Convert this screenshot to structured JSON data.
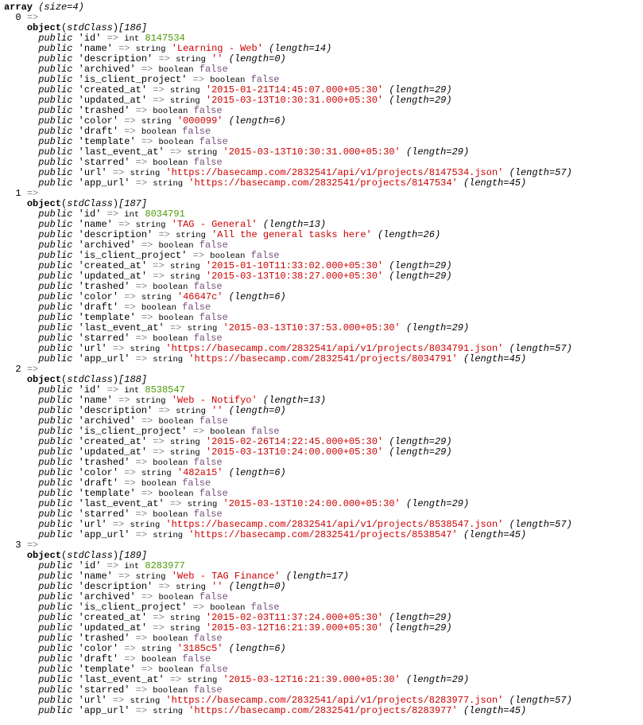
{
  "dump": {
    "root_type": "array",
    "root_size_label": "(size=4)",
    "arrow": "=>",
    "visibility": "public",
    "object_label": "object",
    "class_name": "stdClass",
    "colors": {
      "int": "#4e9a06",
      "string": "#cc0000",
      "boolean": "#75507b",
      "arrow": "#888a85"
    },
    "items": [
      {
        "index": "0",
        "handle": "[186]",
        "props": [
          {
            "key": "'id'",
            "type": "int",
            "value": "8147534",
            "meta": ""
          },
          {
            "key": "'name'",
            "type": "string",
            "value": "'Learning - Web'",
            "meta": "(length=14)"
          },
          {
            "key": "'description'",
            "type": "string",
            "value": "''",
            "meta": "(length=0)"
          },
          {
            "key": "'archived'",
            "type": "boolean",
            "value": "false",
            "meta": ""
          },
          {
            "key": "'is_client_project'",
            "type": "boolean",
            "value": "false",
            "meta": ""
          },
          {
            "key": "'created_at'",
            "type": "string",
            "value": "'2015-01-21T14:45:07.000+05:30'",
            "meta": "(length=29)"
          },
          {
            "key": "'updated_at'",
            "type": "string",
            "value": "'2015-03-13T10:30:31.000+05:30'",
            "meta": "(length=29)"
          },
          {
            "key": "'trashed'",
            "type": "boolean",
            "value": "false",
            "meta": ""
          },
          {
            "key": "'color'",
            "type": "string",
            "value": "'000099'",
            "meta": "(length=6)"
          },
          {
            "key": "'draft'",
            "type": "boolean",
            "value": "false",
            "meta": ""
          },
          {
            "key": "'template'",
            "type": "boolean",
            "value": "false",
            "meta": ""
          },
          {
            "key": "'last_event_at'",
            "type": "string",
            "value": "'2015-03-13T10:30:31.000+05:30'",
            "meta": "(length=29)"
          },
          {
            "key": "'starred'",
            "type": "boolean",
            "value": "false",
            "meta": ""
          },
          {
            "key": "'url'",
            "type": "string",
            "value": "'https://basecamp.com/2832541/api/v1/projects/8147534.json'",
            "meta": "(length=57)"
          },
          {
            "key": "'app_url'",
            "type": "string",
            "value": "'https://basecamp.com/2832541/projects/8147534'",
            "meta": "(length=45)"
          }
        ]
      },
      {
        "index": "1",
        "handle": "[187]",
        "props": [
          {
            "key": "'id'",
            "type": "int",
            "value": "8034791",
            "meta": ""
          },
          {
            "key": "'name'",
            "type": "string",
            "value": "'TAG - General'",
            "meta": "(length=13)"
          },
          {
            "key": "'description'",
            "type": "string",
            "value": "'All the general tasks here'",
            "meta": "(length=26)"
          },
          {
            "key": "'archived'",
            "type": "boolean",
            "value": "false",
            "meta": ""
          },
          {
            "key": "'is_client_project'",
            "type": "boolean",
            "value": "false",
            "meta": ""
          },
          {
            "key": "'created_at'",
            "type": "string",
            "value": "'2015-01-10T11:33:02.000+05:30'",
            "meta": "(length=29)"
          },
          {
            "key": "'updated_at'",
            "type": "string",
            "value": "'2015-03-13T10:38:27.000+05:30'",
            "meta": "(length=29)"
          },
          {
            "key": "'trashed'",
            "type": "boolean",
            "value": "false",
            "meta": ""
          },
          {
            "key": "'color'",
            "type": "string",
            "value": "'46647c'",
            "meta": "(length=6)"
          },
          {
            "key": "'draft'",
            "type": "boolean",
            "value": "false",
            "meta": ""
          },
          {
            "key": "'template'",
            "type": "boolean",
            "value": "false",
            "meta": ""
          },
          {
            "key": "'last_event_at'",
            "type": "string",
            "value": "'2015-03-13T10:37:53.000+05:30'",
            "meta": "(length=29)"
          },
          {
            "key": "'starred'",
            "type": "boolean",
            "value": "false",
            "meta": ""
          },
          {
            "key": "'url'",
            "type": "string",
            "value": "'https://basecamp.com/2832541/api/v1/projects/8034791.json'",
            "meta": "(length=57)"
          },
          {
            "key": "'app_url'",
            "type": "string",
            "value": "'https://basecamp.com/2832541/projects/8034791'",
            "meta": "(length=45)"
          }
        ]
      },
      {
        "index": "2",
        "handle": "[188]",
        "props": [
          {
            "key": "'id'",
            "type": "int",
            "value": "8538547",
            "meta": ""
          },
          {
            "key": "'name'",
            "type": "string",
            "value": "'Web - Notifyo'",
            "meta": "(length=13)"
          },
          {
            "key": "'description'",
            "type": "string",
            "value": "''",
            "meta": "(length=0)"
          },
          {
            "key": "'archived'",
            "type": "boolean",
            "value": "false",
            "meta": ""
          },
          {
            "key": "'is_client_project'",
            "type": "boolean",
            "value": "false",
            "meta": ""
          },
          {
            "key": "'created_at'",
            "type": "string",
            "value": "'2015-02-26T14:22:45.000+05:30'",
            "meta": "(length=29)"
          },
          {
            "key": "'updated_at'",
            "type": "string",
            "value": "'2015-03-13T10:24:00.000+05:30'",
            "meta": "(length=29)"
          },
          {
            "key": "'trashed'",
            "type": "boolean",
            "value": "false",
            "meta": ""
          },
          {
            "key": "'color'",
            "type": "string",
            "value": "'482a15'",
            "meta": "(length=6)"
          },
          {
            "key": "'draft'",
            "type": "boolean",
            "value": "false",
            "meta": ""
          },
          {
            "key": "'template'",
            "type": "boolean",
            "value": "false",
            "meta": ""
          },
          {
            "key": "'last_event_at'",
            "type": "string",
            "value": "'2015-03-13T10:24:00.000+05:30'",
            "meta": "(length=29)"
          },
          {
            "key": "'starred'",
            "type": "boolean",
            "value": "false",
            "meta": ""
          },
          {
            "key": "'url'",
            "type": "string",
            "value": "'https://basecamp.com/2832541/api/v1/projects/8538547.json'",
            "meta": "(length=57)"
          },
          {
            "key": "'app_url'",
            "type": "string",
            "value": "'https://basecamp.com/2832541/projects/8538547'",
            "meta": "(length=45)"
          }
        ]
      },
      {
        "index": "3",
        "handle": "[189]",
        "props": [
          {
            "key": "'id'",
            "type": "int",
            "value": "8283977",
            "meta": ""
          },
          {
            "key": "'name'",
            "type": "string",
            "value": "'Web - TAG Finance'",
            "meta": "(length=17)"
          },
          {
            "key": "'description'",
            "type": "string",
            "value": "''",
            "meta": "(length=0)"
          },
          {
            "key": "'archived'",
            "type": "boolean",
            "value": "false",
            "meta": ""
          },
          {
            "key": "'is_client_project'",
            "type": "boolean",
            "value": "false",
            "meta": ""
          },
          {
            "key": "'created_at'",
            "type": "string",
            "value": "'2015-02-03T11:37:24.000+05:30'",
            "meta": "(length=29)"
          },
          {
            "key": "'updated_at'",
            "type": "string",
            "value": "'2015-03-12T16:21:39.000+05:30'",
            "meta": "(length=29)"
          },
          {
            "key": "'trashed'",
            "type": "boolean",
            "value": "false",
            "meta": ""
          },
          {
            "key": "'color'",
            "type": "string",
            "value": "'3185c5'",
            "meta": "(length=6)"
          },
          {
            "key": "'draft'",
            "type": "boolean",
            "value": "false",
            "meta": ""
          },
          {
            "key": "'template'",
            "type": "boolean",
            "value": "false",
            "meta": ""
          },
          {
            "key": "'last_event_at'",
            "type": "string",
            "value": "'2015-03-12T16:21:39.000+05:30'",
            "meta": "(length=29)"
          },
          {
            "key": "'starred'",
            "type": "boolean",
            "value": "false",
            "meta": ""
          },
          {
            "key": "'url'",
            "type": "string",
            "value": "'https://basecamp.com/2832541/api/v1/projects/8283977.json'",
            "meta": "(length=57)"
          },
          {
            "key": "'app_url'",
            "type": "string",
            "value": "'https://basecamp.com/2832541/projects/8283977'",
            "meta": "(length=45)"
          }
        ]
      }
    ]
  }
}
